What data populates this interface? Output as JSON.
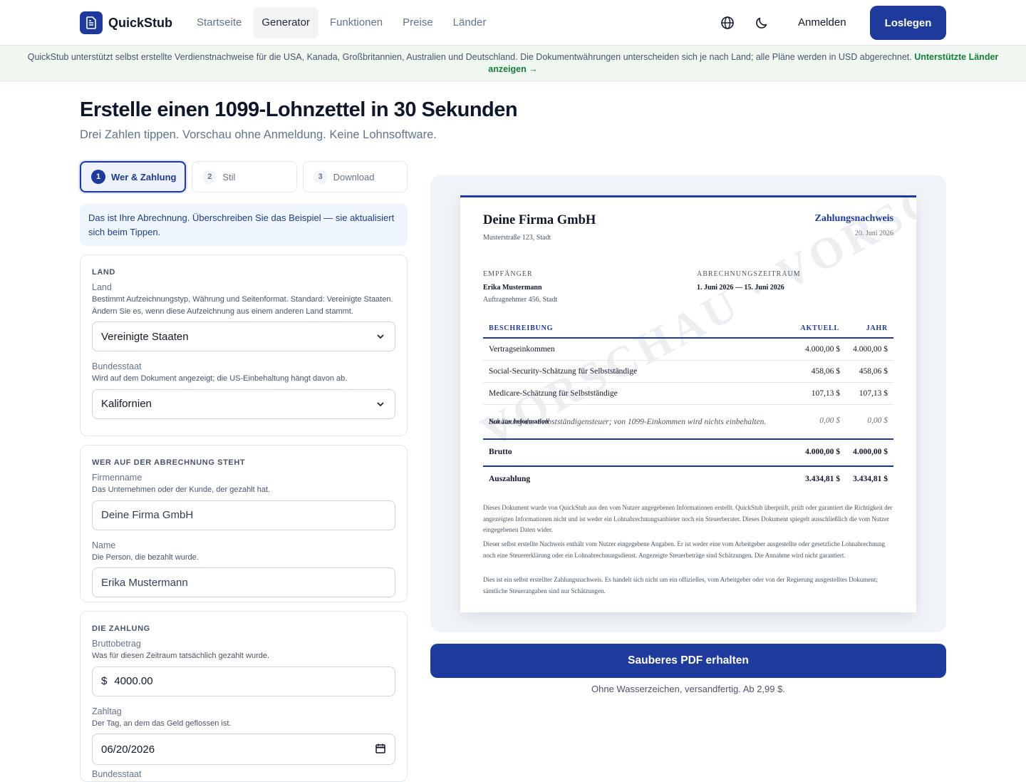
{
  "header": {
    "brand": "QuickStub",
    "nav": [
      "Startseite",
      "Generator",
      "Funktionen",
      "Preise",
      "Länder"
    ],
    "active_nav": "Generator",
    "login": "Anmelden",
    "cta": "Loslegen",
    "icons": {
      "language": "globe-icon",
      "theme": "moon-icon",
      "logo": "document-icon"
    }
  },
  "banner": {
    "text": "QuickStub unterstützt selbst erstellte Verdienstnachweise für die USA, Kanada, Großbritannien, Australien und Deutschland. Die Dokumentwährungen unterscheiden sich je nach Land; alle Pläne werden in USD abgerechnet.",
    "link": "Unterstützte Länder anzeigen →"
  },
  "page": {
    "title": "Erstelle einen 1099-Lohnzettel in 30 Sekunden",
    "subtitle": "Drei Zahlen tippen. Vorschau ohne Anmeldung. Keine Lohnsoftware."
  },
  "steps": [
    {
      "num": "1",
      "label": "Wer & Zahlung"
    },
    {
      "num": "2",
      "label": "Stil"
    },
    {
      "num": "3",
      "label": "Download"
    }
  ],
  "info": "Das ist Ihre Abrechnung. Überschreiben Sie das Beispiel — sie aktualisiert sich beim Tippen.",
  "land": {
    "title": "LAND",
    "country_label": "Land",
    "country_help": "Bestimmt Aufzeichnungstyp, Währung und Seitenformat. Standard: Vereinigte Staaten. Ändern Sie es, wenn diese Aufzeichnung aus einem anderen Land stammt.",
    "country_value": "Vereinigte Staaten",
    "state_label": "Bundesstaat",
    "state_help": "Wird auf dem Dokument angezeigt; die US-Einbehaltung hängt davon ab.",
    "state_value": "Kalifornien"
  },
  "who": {
    "title": "WER AUF DER ABRECHNUNG STEHT",
    "company_label": "Firmenname",
    "company_help": "Das Unternehmen oder der Kunde, der gezahlt hat.",
    "company_value": "Deine Firma GmbH",
    "name_label": "Name",
    "name_help": "Die Person, die bezahlt wurde.",
    "name_value": "Erika Mustermann"
  },
  "payment": {
    "title": "DIE ZAHLUNG",
    "gross_label": "Bruttobetrag",
    "gross_help": "Was für diesen Zeitraum tatsächlich gezahlt wurde.",
    "currency_symbol": "$",
    "gross_value": "4000.00",
    "date_label": "Zahltag",
    "date_help": "Der Tag, an dem das Geld geflossen ist.",
    "date_value": "06/20/2026",
    "next_label": "Bundesstaat"
  },
  "doc": {
    "company": "Deine Firma GmbH",
    "address": "Musterstraße 123, Stadt",
    "title": "Zahlungsnachweis",
    "date": "20. Juni 2026",
    "recipient_label": "EMPFÄNGER",
    "recipient_name": "Erika Mustermann",
    "recipient_addr": "Auftragnehmer 456, Stadt",
    "period_label": "ABRECHNUNGSZEITRAUM",
    "period_value": "1. Juni 2026 — 15. Juni 2026",
    "col_desc": "BESCHREIBUNG",
    "col_current": "AKTUELL",
    "col_year": "JAHR",
    "rows": [
      {
        "desc": "Vertragseinkommen",
        "current": "4.000,00 $",
        "year": "4.000,00 $"
      },
      {
        "desc": "Social-Security-Schätzung für Selbstständige",
        "current": "458,06 $",
        "year": "458,06 $"
      },
      {
        "desc": "Medicare-Schätzung für Selbstständige",
        "current": "107,13 $",
        "year": "107,13 $"
      }
    ],
    "note_tag": "Nur zur Information",
    "note_text": "Schätzung der Selbstständigensteuer; von 1099-Einkommen wird nichts einbehalten.",
    "note_current": "0,00 $",
    "note_year": "0,00 $",
    "gross_label": "Brutto",
    "gross_current": "4.000,00 $",
    "gross_year": "4.000,00 $",
    "pay_label": "Auszahlung",
    "pay_current": "3.434,81 $",
    "pay_year": "3.434,81 $",
    "disclaimer1": "Dieses Dokument wurde von QuickStub aus den vom Nutzer angegebenen Informationen erstellt. QuickStub überprüft, prüft oder garantiert die Richtigkeit der angezeigten Informationen nicht und ist weder ein Lohnabrechnungsanbieter noch ein Steuerberater. Dieses Dokument spiegelt ausschließlich die vom Nutzer eingegebenen Daten wider.",
    "disclaimer2": "Dieser selbst erstellte Nachweis enthält vom Nutzer eingegebene Angaben. Er ist weder eine vom Arbeitgeber ausgestellte oder gesetzliche Lohnabrechnung noch eine Steuererklärung oder ein Lohnabrechnungsdienst. Angezeigte Steuerbeträge sind Schätzungen. Die Annahme wird nicht garantiert.",
    "disclaimer3": "Dies ist ein selbst erstellter Zahlungsnachweis. Es handelt sich nicht um ein offizielles, vom Arbeitgeber oder von der Regierung ausgestelltes Dokument; sämtliche Steuerangaben sind nur Schätzungen.",
    "watermark": "VORSCHAU · VORSCHAU"
  },
  "pdf": {
    "button": "Sauberes PDF erhalten",
    "note": "Ohne Wasserzeichen, versandfertig. Ab 2,99 $."
  },
  "colors": {
    "primary": "#1e3a9c",
    "banner_bg": "#f0f7f1",
    "link_green": "#15803d",
    "info_bg": "#eff6ff"
  }
}
